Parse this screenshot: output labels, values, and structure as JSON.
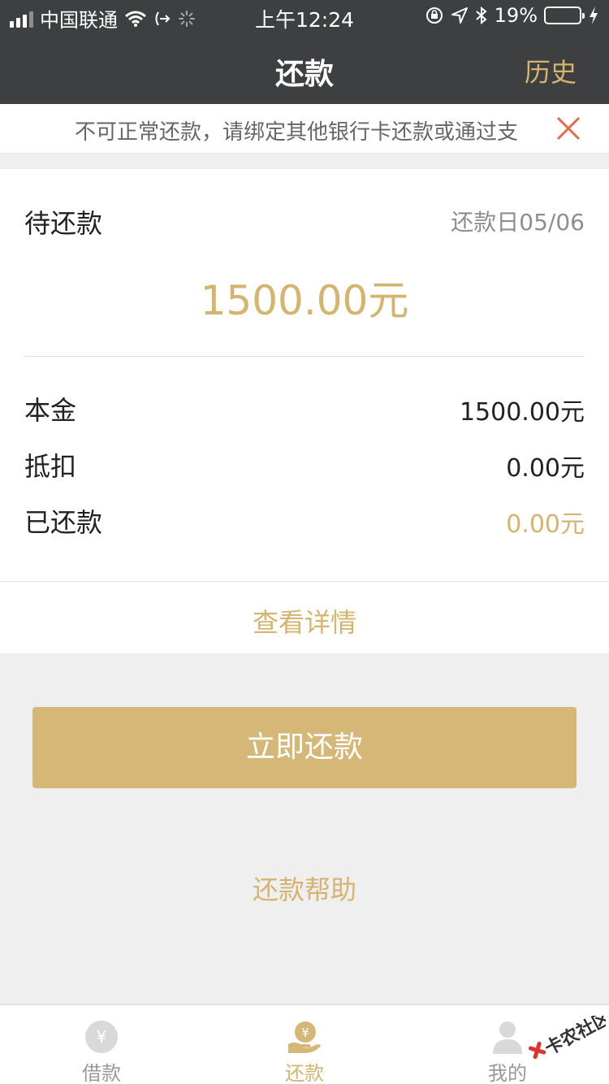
{
  "status": {
    "carrier": "中国联通",
    "time": "上午12:24",
    "battery": "19%",
    "battery_level": 0.19
  },
  "nav": {
    "title": "还款",
    "history": "历史"
  },
  "notice": {
    "text": "不可正常还款，请绑定其他银行卡还款或通过支"
  },
  "summary": {
    "due_label": "待还款",
    "due_date": "还款日05/06",
    "amount": "1500.00元"
  },
  "breakdown": [
    {
      "label": "本金",
      "value": "1500.00元"
    },
    {
      "label": "抵扣",
      "value": "0.00元"
    },
    {
      "label": "已还款",
      "value": "0.00元"
    }
  ],
  "actions": {
    "details": "查看详情",
    "pay_now": "立即还款",
    "help": "还款帮助"
  },
  "tabs": [
    {
      "label": "借款",
      "icon": "yen-coin-icon"
    },
    {
      "label": "还款",
      "icon": "yen-hand-icon"
    },
    {
      "label": "我的",
      "icon": "user-icon"
    }
  ],
  "watermark": "卡农社区",
  "colors": {
    "header": "#3d3f41",
    "accent": "#d4b46e",
    "button": "#d5b877",
    "close": "#e36a4f"
  }
}
